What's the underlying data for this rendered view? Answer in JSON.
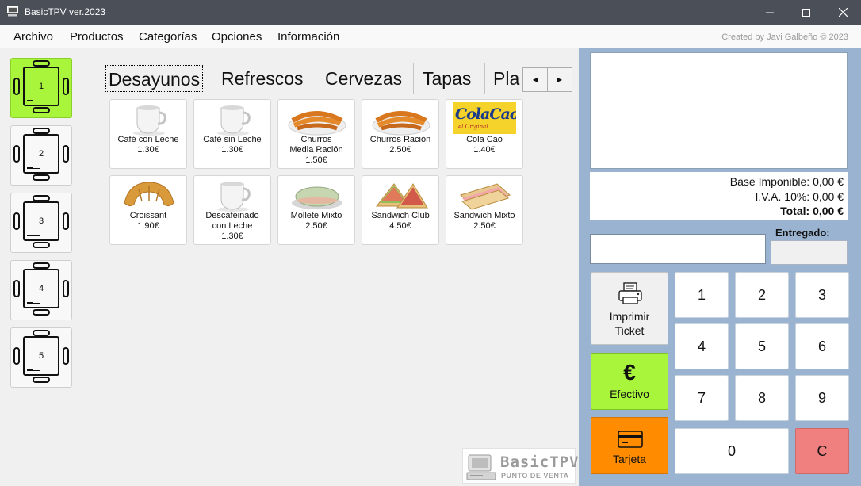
{
  "window": {
    "title": "BasicTPV ver.2023"
  },
  "menu": {
    "items": [
      "Archivo",
      "Productos",
      "Categorías",
      "Opciones",
      "Información"
    ],
    "credit": "Created by Javi Galbeño © 2023"
  },
  "tables": [
    {
      "label": "1",
      "active": true
    },
    {
      "label": "2",
      "active": false
    },
    {
      "label": "3",
      "active": false
    },
    {
      "label": "4",
      "active": false
    },
    {
      "label": "5",
      "active": false
    }
  ],
  "categories": {
    "tabs": [
      "Desayunos",
      "Refrescos",
      "Cervezas",
      "Tapas",
      "Pla"
    ],
    "active": "Desayunos"
  },
  "products": [
    {
      "name": "Café con Leche",
      "price": "1.30€",
      "icon": "coffee-cup-icon"
    },
    {
      "name": "Café sin Leche",
      "price": "1.30€",
      "icon": "coffee-cup-icon"
    },
    {
      "name": "Churros Media Ración",
      "price": "1.50€",
      "icon": "churros-icon"
    },
    {
      "name": "Churros Ración",
      "price": "2.50€",
      "icon": "churros-icon"
    },
    {
      "name": "Cola Cao",
      "price": "1.40€",
      "icon": "colacao-icon",
      "brand_text": "ColaCao",
      "brand_sub": "el Original"
    },
    {
      "name": "Croissant",
      "price": "1.90€",
      "icon": "croissant-icon"
    },
    {
      "name": "Descafeinado con Leche",
      "price": "1.30€",
      "icon": "coffee-cup-icon"
    },
    {
      "name": "Mollete Mixto",
      "price": "2.50€",
      "icon": "mollete-icon"
    },
    {
      "name": "Sandwich Club",
      "price": "4.50€",
      "icon": "sandwich-icon"
    },
    {
      "name": "Sandwich Mixto",
      "price": "2.50€",
      "icon": "sandwich-icon"
    }
  ],
  "logo": {
    "name": "BasicTPV",
    "tagline": "PUNTO DE VENTA"
  },
  "totals": {
    "base": "Base Imponible: 0,00 €",
    "iva": "I.V.A. 10%: 0,00 €",
    "total": "Total: 0,00 €"
  },
  "payment": {
    "entregado_label": "Entregado:",
    "print_label": "Imprimir Ticket",
    "cash_label": "Efectivo",
    "cash_symbol": "€",
    "card_label": "Tarjeta"
  },
  "keypad": [
    "1",
    "2",
    "3",
    "4",
    "5",
    "6",
    "7",
    "8",
    "9",
    "0",
    "C"
  ],
  "colors": {
    "active_table": "#a8f53c",
    "cash_button": "#a8f53c",
    "card_button": "#ff8c00",
    "clear_button": "#f08080",
    "right_panel": "#99b3d0",
    "titlebar": "#4a4f58"
  }
}
